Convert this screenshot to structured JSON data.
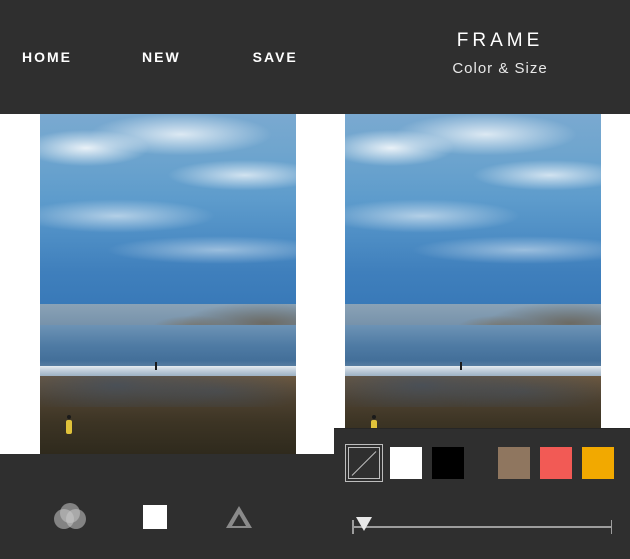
{
  "nav": {
    "home": "HOME",
    "new": "NEW",
    "save": "SAVE"
  },
  "panel": {
    "title": "FRAME",
    "subtitle": "Color & Size"
  },
  "tools": {
    "filters_name": "filters-tool",
    "frame_name": "frame-tool",
    "adjust_name": "adjust-tool"
  },
  "frame": {
    "swatches": [
      {
        "name": "no-frame",
        "css": "none",
        "selected": true
      },
      {
        "name": "white",
        "css": "white",
        "selected": false
      },
      {
        "name": "black",
        "css": "black",
        "selected": false
      },
      {
        "name": "taupe",
        "css": "taupe",
        "selected": false
      },
      {
        "name": "red",
        "css": "red",
        "selected": false
      },
      {
        "name": "amber",
        "css": "amber",
        "selected": false
      }
    ],
    "slider": {
      "min": 0,
      "max": 100,
      "value": 4
    }
  }
}
